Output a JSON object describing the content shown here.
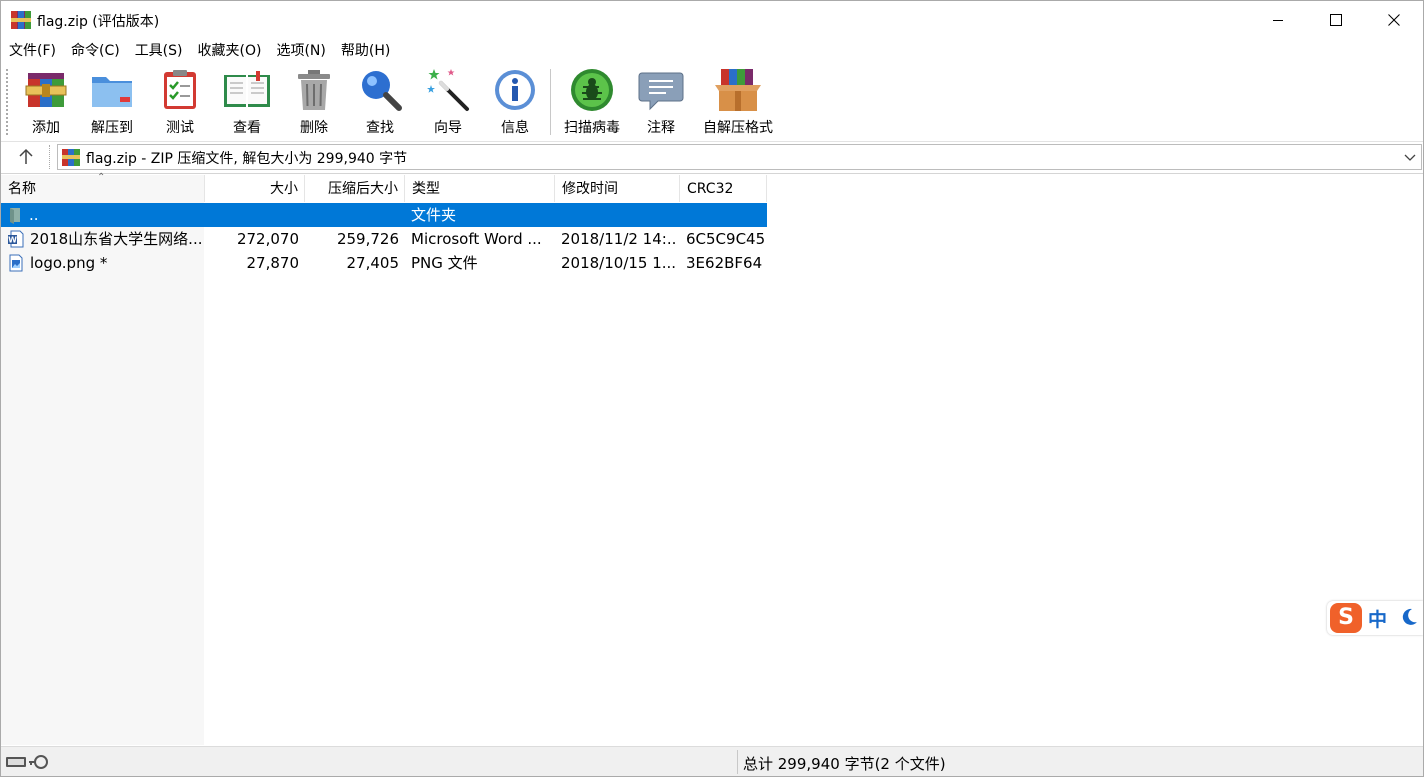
{
  "window": {
    "title": "flag.zip (评估版本)"
  },
  "menu": [
    "文件(F)",
    "命令(C)",
    "工具(S)",
    "收藏夹(O)",
    "选项(N)",
    "帮助(H)"
  ],
  "toolbar": {
    "buttons": [
      {
        "label": "添加",
        "icon": "add-archive-icon"
      },
      {
        "label": "解压到",
        "icon": "extract-folder-icon"
      },
      {
        "label": "测试",
        "icon": "test-clipboard-icon"
      },
      {
        "label": "查看",
        "icon": "view-book-icon"
      },
      {
        "label": "删除",
        "icon": "trash-icon"
      },
      {
        "label": "查找",
        "icon": "magnifier-icon"
      },
      {
        "label": "向导",
        "icon": "wizard-wand-icon"
      },
      {
        "label": "信息",
        "icon": "info-icon"
      },
      {
        "label": "扫描病毒",
        "icon": "virus-scan-icon"
      },
      {
        "label": "注释",
        "icon": "comment-icon"
      },
      {
        "label": "自解压格式",
        "icon": "sfx-box-icon"
      }
    ]
  },
  "address": {
    "text": "flag.zip - ZIP 压缩文件, 解包大小为 299,940 字节"
  },
  "columns": [
    "名称",
    "大小",
    "压缩后大小",
    "类型",
    "修改时间",
    "CRC32"
  ],
  "rows": [
    {
      "name": "..",
      "size": "",
      "packed": "",
      "type": "文件夹",
      "modified": "",
      "crc": "",
      "icon": "parent-folder-icon",
      "selected": true
    },
    {
      "name": "2018山东省大学生网络...",
      "size": "272,070",
      "packed": "259,726",
      "type": "Microsoft Word ...",
      "modified": "2018/11/2 14:...",
      "crc": "6C5C9C45",
      "icon": "word-document-icon",
      "selected": false
    },
    {
      "name": "logo.png *",
      "size": "27,870",
      "packed": "27,405",
      "type": "PNG 文件",
      "modified": "2018/10/15 1...",
      "crc": "3E62BF64",
      "icon": "image-file-icon",
      "selected": false
    }
  ],
  "ime": {
    "logo": "S",
    "mode": "中"
  },
  "status": {
    "text": "总计 299,940 字节(2 个文件)"
  },
  "colors": {
    "selection": "#0078d7",
    "ime_logo": "#f0612a",
    "ime_text": "#1768c9"
  }
}
